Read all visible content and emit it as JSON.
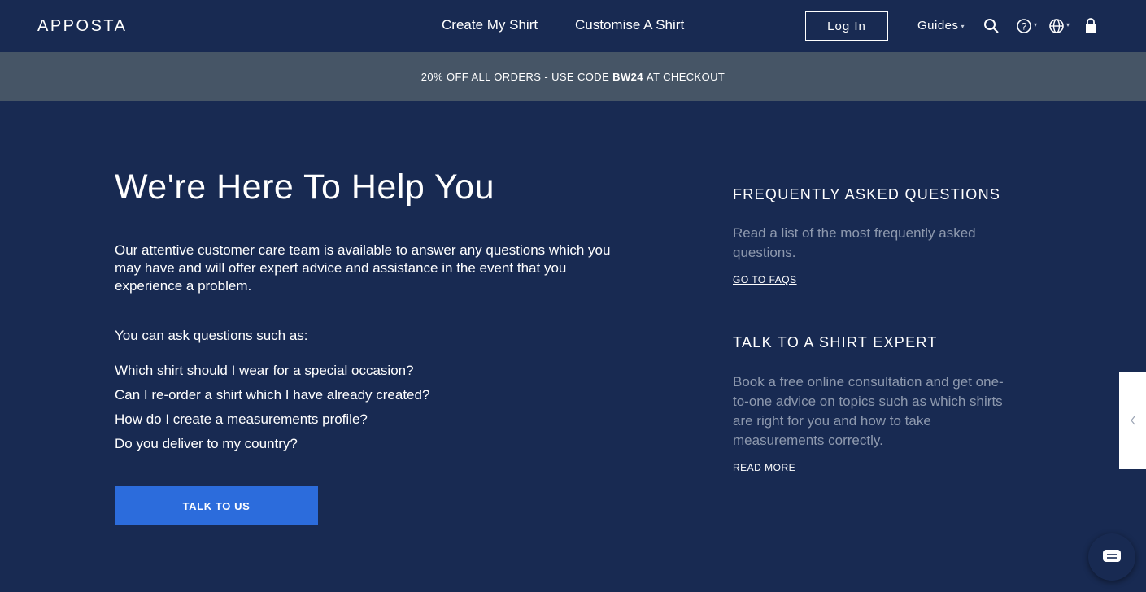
{
  "header": {
    "logo": "APPOSTA",
    "nav": [
      "Create My Shirt",
      "Customise A Shirt"
    ],
    "login_label": "Log In",
    "guides_label": "Guides",
    "caret": "⌄"
  },
  "promo": {
    "prefix": "20% OFF ALL ORDERS - USE CODE",
    "code": "BW24",
    "suffix": "AT CHECKOUT"
  },
  "main": {
    "title": "We're Here To Help You",
    "intro": "Our attentive customer care team is available to answer any questions which you may have and will offer expert advice and assistance in the event that you experience a problem.",
    "ask_label": "You can ask questions such as:",
    "questions": [
      "Which shirt should I wear for a special occasion?",
      "Can I re-order a shirt which I have already created?",
      "How do I create a measurements profile?",
      "Do you deliver to my country?"
    ],
    "cta_label": "TALK TO US"
  },
  "sidebar": {
    "faq": {
      "heading": "FREQUENTLY ASKED QUESTIONS",
      "text": "Read a list of the most frequently asked questions.",
      "link": "GO TO FAQS"
    },
    "expert": {
      "heading": "TALK TO A SHIRT EXPERT",
      "text": "Book a free online consultation and get one-to-one advice on topics such as which shirts are right for you and how to take measurements correctly.",
      "link": "READ MORE"
    }
  },
  "colors": {
    "background": "#182a52",
    "promo_bar": "#465566",
    "cta": "#2c6cdc",
    "muted_text": "#8e99ae"
  },
  "icons": [
    "search-icon",
    "help-icon",
    "globe-icon",
    "cart-icon",
    "chevron-left-icon",
    "chat-icon"
  ]
}
